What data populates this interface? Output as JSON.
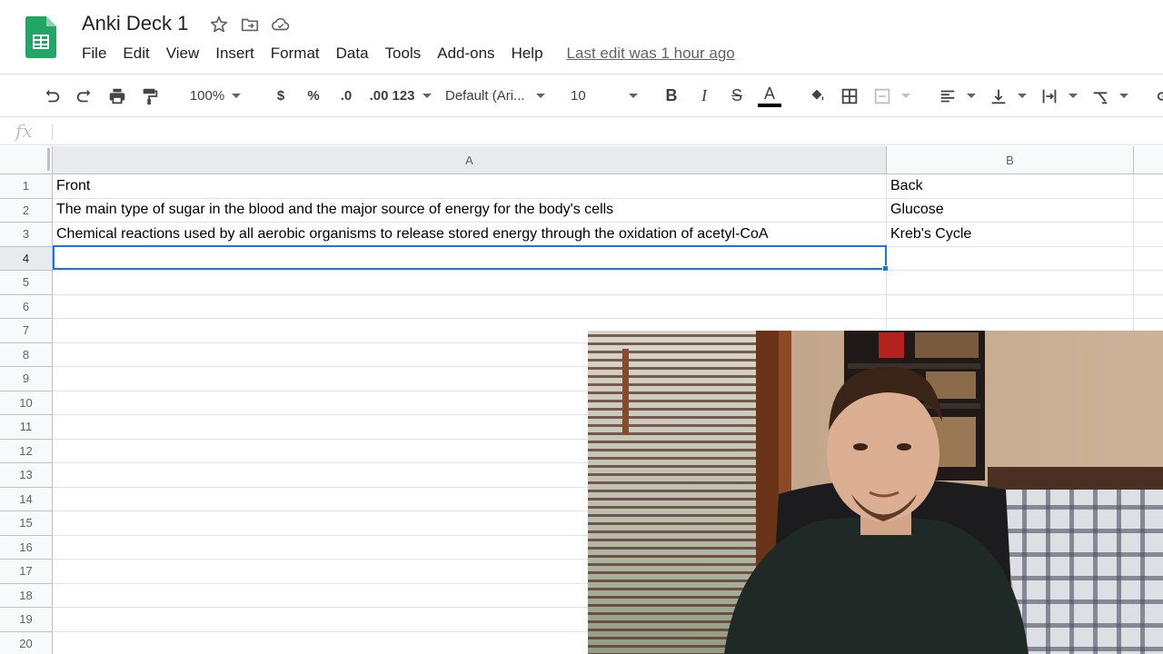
{
  "app": {
    "doc_title": "Anki Deck 1",
    "menus": [
      "File",
      "Edit",
      "View",
      "Insert",
      "Format",
      "Data",
      "Tools",
      "Add-ons",
      "Help"
    ],
    "last_edit": "Last edit was 1 hour ago"
  },
  "toolbar": {
    "zoom": "100%",
    "currency": "$",
    "percent": "%",
    "decrease_decimals": ".0",
    "increase_decimals": ".00",
    "more_formats": "123",
    "font": "Default (Ari...",
    "font_size": "10",
    "bold": "B",
    "italic": "I",
    "strike": "S",
    "text_color": "A"
  },
  "formula_bar": {
    "fx": "fx",
    "value": ""
  },
  "sheet": {
    "columns": [
      "A",
      "B"
    ],
    "active_column": "A",
    "active_row": "4",
    "rows": [
      {
        "num": "1",
        "a": "Front",
        "b": "Back"
      },
      {
        "num": "2",
        "a": "The main type of sugar in the blood and the major source of energy for the body's cells",
        "b": "Glucose"
      },
      {
        "num": "3",
        "a": "Chemical reactions used by all aerobic organisms to release stored energy through the oxidation of acetyl-CoA",
        "b": "Kreb's Cycle"
      },
      {
        "num": "4",
        "a": "",
        "b": ""
      },
      {
        "num": "5",
        "a": "",
        "b": ""
      },
      {
        "num": "6",
        "a": "",
        "b": ""
      },
      {
        "num": "7",
        "a": "",
        "b": ""
      },
      {
        "num": "8",
        "a": "",
        "b": ""
      },
      {
        "num": "9",
        "a": "",
        "b": ""
      },
      {
        "num": "10",
        "a": "",
        "b": ""
      },
      {
        "num": "11",
        "a": "",
        "b": ""
      },
      {
        "num": "12",
        "a": "",
        "b": ""
      },
      {
        "num": "13",
        "a": "",
        "b": ""
      },
      {
        "num": "14",
        "a": "",
        "b": ""
      },
      {
        "num": "15",
        "a": "",
        "b": ""
      },
      {
        "num": "16",
        "a": "",
        "b": ""
      },
      {
        "num": "17",
        "a": "",
        "b": ""
      },
      {
        "num": "18",
        "a": "",
        "b": ""
      },
      {
        "num": "19",
        "a": "",
        "b": ""
      },
      {
        "num": "20",
        "a": "",
        "b": ""
      }
    ]
  },
  "colors": {
    "sheets_green": "#23a566",
    "selection_blue": "#1a73e8"
  }
}
